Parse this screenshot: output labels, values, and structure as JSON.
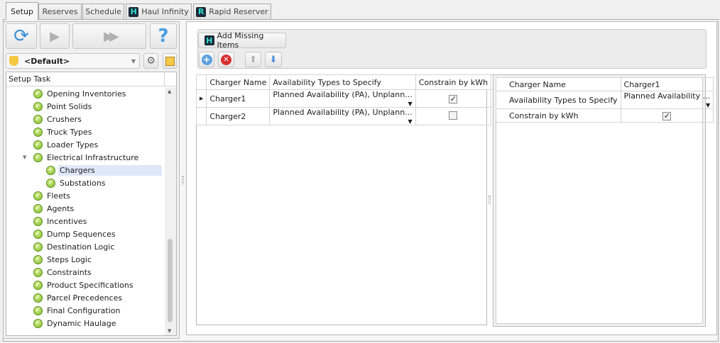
{
  "tabs": [
    {
      "label": "Setup",
      "active": true
    },
    {
      "label": "Reserves"
    },
    {
      "label": "Schedule"
    },
    {
      "label": "Haul Infinity",
      "logo": "H"
    },
    {
      "label": "Rapid Reserver",
      "logo": "R"
    }
  ],
  "left": {
    "profile": "<Default>",
    "tree_header": "Setup Task",
    "items": [
      {
        "label": "Opening Inventories",
        "level": 1
      },
      {
        "label": "Point Solids",
        "level": 1
      },
      {
        "label": "Crushers",
        "level": 1
      },
      {
        "label": "Truck Types",
        "level": 1
      },
      {
        "label": "Loader Types",
        "level": 1
      },
      {
        "label": "Electrical Infrastructure",
        "level": 1,
        "expanded": true
      },
      {
        "label": "Chargers",
        "level": 2,
        "selected": true
      },
      {
        "label": "Substations",
        "level": 2
      },
      {
        "label": "Fleets",
        "level": 1
      },
      {
        "label": "Agents",
        "level": 1
      },
      {
        "label": "Incentives",
        "level": 1
      },
      {
        "label": "Dump Sequences",
        "level": 1
      },
      {
        "label": "Destination Logic",
        "level": 1
      },
      {
        "label": "Steps Logic",
        "level": 1
      },
      {
        "label": "Constraints",
        "level": 1
      },
      {
        "label": "Product Specifications",
        "level": 1
      },
      {
        "label": "Parcel Precedences",
        "level": 1
      },
      {
        "label": "Final Configuration",
        "level": 1
      },
      {
        "label": "Dynamic Haulage",
        "level": 1
      }
    ]
  },
  "toolbar": {
    "add_missing": "Add Missing Items"
  },
  "grid": {
    "columns": [
      "Charger Name",
      "Availability Types to Specify",
      "Constrain by kWh"
    ],
    "rows": [
      {
        "name": "Charger1",
        "types": "Planned Availability (PA), Unplann...",
        "kwh": true
      },
      {
        "name": "Charger2",
        "types": "Planned Availability (PA), Unplann...",
        "kwh": false
      }
    ]
  },
  "props": {
    "rows": [
      {
        "label": "Charger Name",
        "value": "Charger1"
      },
      {
        "label": "Availability Types to Specify",
        "value": "Planned Availability ..."
      },
      {
        "label": "Constrain by kWh",
        "value": "✓"
      }
    ]
  }
}
